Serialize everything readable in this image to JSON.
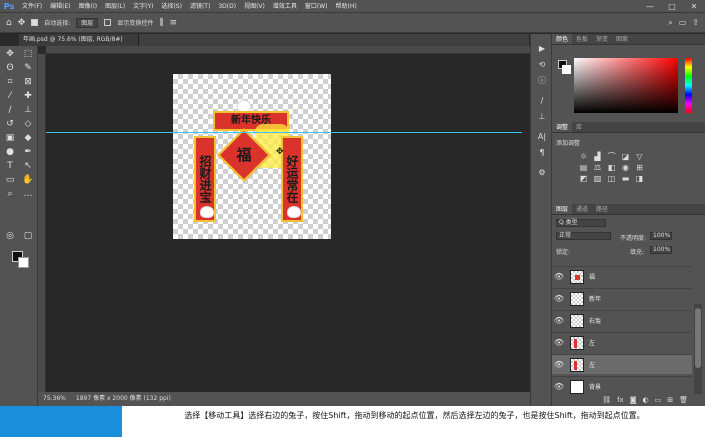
{
  "menubar": {
    "logo": "Ps",
    "items": [
      "文件(F)",
      "编辑(E)",
      "图像(I)",
      "图层(L)",
      "文字(Y)",
      "选择(S)",
      "滤镜(T)",
      "3D(D)",
      "视图(V)",
      "增效工具",
      "窗口(W)",
      "帮助(H)"
    ],
    "minimize": "—",
    "maximize": "□",
    "close": "✕"
  },
  "options": {
    "home_icon": "home-icon",
    "auto_select_label": "自动选择:",
    "auto_select_value": "图层",
    "transform_label": "显示变换控件"
  },
  "document": {
    "tab_label": "年画.psd @ 75.6% (图层, RGB/8#)",
    "banner_text": "新年快乐",
    "left_scroll_text": "招财进宝",
    "right_scroll_text": "好运常在",
    "center_char": "福"
  },
  "status": {
    "zoom": "75.36%",
    "doc_info": "1897 像素 x 2000 像素 (132 ppi)"
  },
  "panels": {
    "color_tabs": [
      "颜色",
      "色板",
      "渐变",
      "图案"
    ],
    "adjust_tabs": [
      "调整",
      "库"
    ],
    "adjust_title": "添加调整",
    "layers_tabs": [
      "图层",
      "通道",
      "路径"
    ],
    "layer_kind": "Q 类型",
    "blend_mode": "正常",
    "opacity_label": "不透明度:",
    "opacity_value": "100%",
    "lock_label": "锁定:",
    "fill_label": "填充:",
    "fill_value": "100%",
    "layers": [
      {
        "name": "福"
      },
      {
        "name": "新年"
      },
      {
        "name": "右兔"
      },
      {
        "name": "左"
      },
      {
        "name": "左"
      },
      {
        "name": "背景"
      }
    ]
  },
  "caption": {
    "text": "选择【移动工具】选择右边的兔子，按住Shift，拖动到移动的起点位置，然后选择左边的兔子，也是按住Shift，拖动到起点位置。"
  },
  "colors": {
    "accent": "#1a8ed8",
    "guide": "#35c4ff",
    "red": "#d9332c",
    "gold": "#f2c230"
  }
}
